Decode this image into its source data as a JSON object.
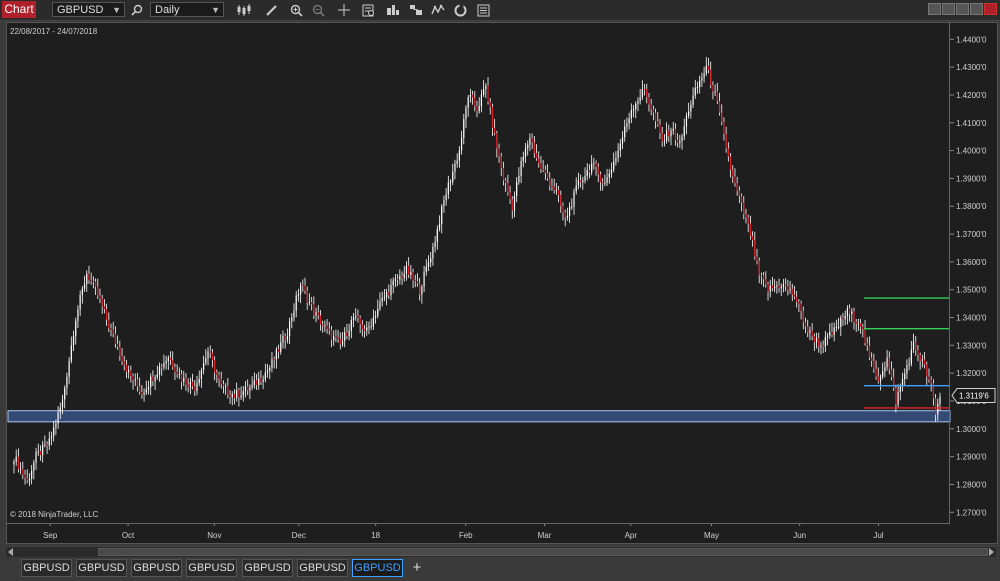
{
  "toolbar": {
    "chart_label": "Chart",
    "instrument": "GBPUSD",
    "interval": "Daily",
    "icons": [
      "search-icon",
      "bar-type-icon",
      "draw-icon",
      "zoom-in-icon",
      "zoom-out-icon",
      "crosshair-icon",
      "data-box-icon",
      "order-icon",
      "strategy-icon",
      "indicator-icon",
      "refresh-icon",
      "properties-icon"
    ]
  },
  "chart": {
    "date_range": "22/08/2017 - 24/07/2018",
    "copyright": "© 2018 NinjaTrader, LLC",
    "current_price_label": "1.3119'6"
  },
  "chart_data": {
    "type": "candlestick",
    "instrument": "GBPUSD",
    "interval": "Daily",
    "price_ticks": [
      "1.4400'0",
      "1.4300'0",
      "1.4200'0",
      "1.4100'0",
      "1.4000'0",
      "1.3900'0",
      "1.3800'0",
      "1.3700'0",
      "1.3600'0",
      "1.3500'0",
      "1.3400'0",
      "1.3300'0",
      "1.3200'0",
      "1.3100'0",
      "1.3000'0",
      "1.2900'0",
      "1.2800'0",
      "1.2700'0"
    ],
    "time_ticks": [
      "Sep",
      "Oct",
      "Nov",
      "Dec",
      "18",
      "Feb",
      "Mar",
      "Apr",
      "May",
      "Jun",
      "Jul"
    ],
    "ylim": [
      1.2665,
      1.4455
    ],
    "support_zone": [
      1.3025,
      1.3065
    ],
    "horizontal_levels": [
      {
        "price": 1.347,
        "color": "#34d058"
      },
      {
        "price": 1.336,
        "color": "#34d058"
      },
      {
        "price": 1.3155,
        "color": "#3ea0ff"
      },
      {
        "price": 1.3075,
        "color": "#e0202a"
      }
    ],
    "colors": {
      "up": "#ffffff",
      "down": "#e0202a",
      "wick": "#ffffff"
    },
    "anchors": [
      [
        0,
        1.29
      ],
      [
        6,
        1.281
      ],
      [
        10,
        1.29
      ],
      [
        16,
        1.295
      ],
      [
        22,
        1.31
      ],
      [
        28,
        1.34
      ],
      [
        33,
        1.356
      ],
      [
        38,
        1.348
      ],
      [
        44,
        1.335
      ],
      [
        52,
        1.32
      ],
      [
        58,
        1.313
      ],
      [
        64,
        1.32
      ],
      [
        70,
        1.326
      ],
      [
        76,
        1.318
      ],
      [
        82,
        1.315
      ],
      [
        88,
        1.328
      ],
      [
        94,
        1.315
      ],
      [
        100,
        1.312
      ],
      [
        108,
        1.315
      ],
      [
        116,
        1.322
      ],
      [
        124,
        1.335
      ],
      [
        130,
        1.352
      ],
      [
        136,
        1.342
      ],
      [
        142,
        1.335
      ],
      [
        148,
        1.33
      ],
      [
        154,
        1.34
      ],
      [
        160,
        1.335
      ],
      [
        166,
        1.345
      ],
      [
        172,
        1.352
      ],
      [
        178,
        1.357
      ],
      [
        184,
        1.35
      ],
      [
        190,
        1.365
      ],
      [
        196,
        1.385
      ],
      [
        202,
        1.4
      ],
      [
        206,
        1.42
      ],
      [
        210,
        1.415
      ],
      [
        214,
        1.423
      ],
      [
        218,
        1.405
      ],
      [
        222,
        1.39
      ],
      [
        226,
        1.38
      ],
      [
        230,
        1.395
      ],
      [
        234,
        1.405
      ],
      [
        238,
        1.395
      ],
      [
        242,
        1.39
      ],
      [
        246,
        1.385
      ],
      [
        250,
        1.375
      ],
      [
        256,
        1.388
      ],
      [
        262,
        1.395
      ],
      [
        268,
        1.388
      ],
      [
        274,
        1.4
      ],
      [
        280,
        1.415
      ],
      [
        286,
        1.422
      ],
      [
        290,
        1.413
      ],
      [
        294,
        1.403
      ],
      [
        298,
        1.408
      ],
      [
        302,
        1.402
      ],
      [
        306,
        1.415
      ],
      [
        310,
        1.423
      ],
      [
        314,
        1.43
      ],
      [
        318,
        1.42
      ],
      [
        322,
        1.405
      ],
      [
        326,
        1.39
      ],
      [
        330,
        1.38
      ],
      [
        334,
        1.37
      ],
      [
        338,
        1.355
      ],
      [
        342,
        1.35
      ],
      [
        348,
        1.352
      ],
      [
        354,
        1.348
      ],
      [
        360,
        1.335
      ],
      [
        366,
        1.33
      ],
      [
        372,
        1.335
      ],
      [
        378,
        1.342
      ],
      [
        384,
        1.338
      ],
      [
        388,
        1.325
      ],
      [
        392,
        1.318
      ],
      [
        396,
        1.325
      ],
      [
        400,
        1.31
      ],
      [
        404,
        1.32
      ],
      [
        408,
        1.33
      ],
      [
        412,
        1.324
      ],
      [
        416,
        1.315
      ],
      [
        418,
        1.305
      ],
      [
        420,
        1.312
      ]
    ]
  }
}
